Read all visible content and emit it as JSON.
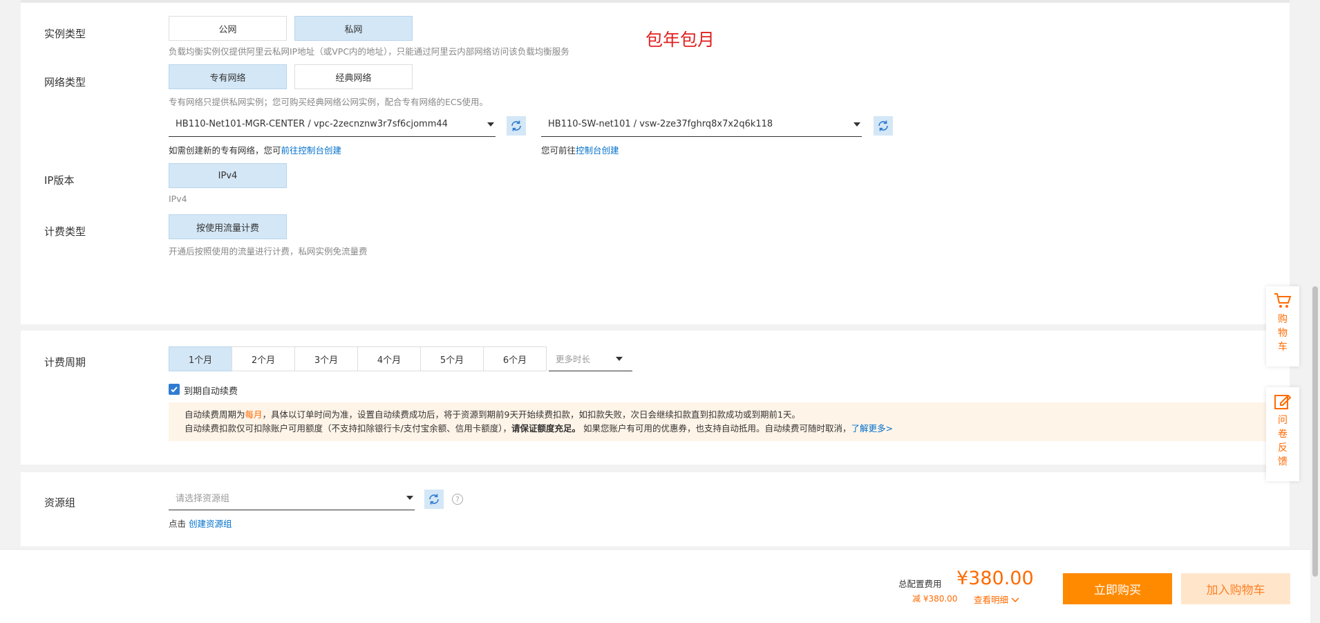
{
  "promo_text": "包年包月",
  "instance_type": {
    "label": "实例类型",
    "options": [
      "公网",
      "私网"
    ],
    "selected": "私网",
    "help": "负载均衡实例仅提供阿里云私网IP地址（或VPC内的地址），只能通过阿里云内部网络访问该负载均衡服务"
  },
  "network_type": {
    "label": "网络类型",
    "options": [
      "专有网络",
      "经典网络"
    ],
    "selected": "专有网络",
    "help": "专有网络只提供私网实例；您可购买经典网络公网实例，配合专有网络的ECS使用。",
    "vpc_value": "HB110-Net101-MGR-CENTER / vpc-2zecnznw3r7sf6cjomm44",
    "vswitch_value": "HB110-SW-net101 / vsw-2ze37fghrq8x7x2q6k118",
    "vpc_help_prefix": "如需创建新的专有网络，您可",
    "vpc_help_link": "前往控制台创建",
    "vsw_help_prefix": "您可前往",
    "vsw_help_link": "控制台创建"
  },
  "ip_version": {
    "label": "IP版本",
    "option": "IPv4",
    "help": "IPv4"
  },
  "billing_type": {
    "label": "计费类型",
    "option": "按使用流量计费",
    "help": "开通后按照使用的流量进行计费，私网实例免流量费"
  },
  "billing_cycle": {
    "label": "计费周期",
    "options": [
      "1个月",
      "2个月",
      "3个月",
      "4个月",
      "5个月",
      "6个月"
    ],
    "selected": "1个月",
    "more": "更多时长",
    "auto_renew_label": "到期自动续费",
    "auto_renew_checked": true,
    "notice_line1_a": "自动续费周期为",
    "notice_line1_hl": "每月",
    "notice_line1_b": "，具体以订单时间为准，设置自动续费成功后，将于资源到期前9天开始续费扣款，如扣款失败，次日会继续扣款直到扣款成功或到期前1天。",
    "notice_line2_a": "自动续费扣款仅可扣除账户可用额度（不支持扣除银行卡/支付宝余额、信用卡额度），",
    "notice_line2_bold": "请保证额度充足。",
    "notice_line2_b": " 如果您账户有可用的优惠券，也支持自动抵用。自动续费可随时取消，",
    "notice_line2_link": "了解更多>"
  },
  "resource_group": {
    "label": "资源组",
    "placeholder": "请选择资源组",
    "help_prefix": "点击 ",
    "help_link": "创建资源组"
  },
  "footer": {
    "price_label": "总配置费用",
    "price": "¥380.00",
    "discount": "减 ¥380.00",
    "detail": "查看明细",
    "buy_button": "立即购买",
    "cart_button": "加入购物车"
  },
  "float_cart": "购物车",
  "float_feedback": "问卷反馈",
  "colors": {
    "accent": "#ff8a00",
    "selected_bg": "#d4e7f6",
    "link": "#0070cc",
    "promo": "#e02020"
  }
}
